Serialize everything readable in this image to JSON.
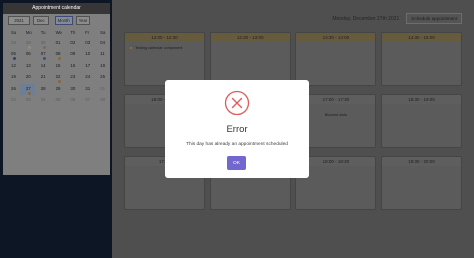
{
  "sidebar": {
    "title": "Appointment calendar",
    "controls": {
      "year": "2021",
      "month": "Dec",
      "view_month": "Month",
      "view_year": "Year"
    },
    "weekdays": [
      "Su",
      "Mo",
      "Tu",
      "We",
      "Th",
      "Fr",
      "Sa"
    ],
    "weeks": [
      [
        {
          "d": "28",
          "m": 1
        },
        {
          "d": "29",
          "m": 1,
          "dot": "#9a8a78"
        },
        {
          "d": "30",
          "m": 1,
          "dot": "#7a6a5a"
        },
        {
          "d": "01"
        },
        {
          "d": "02"
        },
        {
          "d": "03"
        },
        {
          "d": "04"
        }
      ],
      [
        {
          "d": "05",
          "dot": "#2f3f86"
        },
        {
          "d": "06"
        },
        {
          "d": "07",
          "dot": "#3a4a9a"
        },
        {
          "d": "08",
          "dot": "#8a6830"
        },
        {
          "d": "09"
        },
        {
          "d": "10"
        },
        {
          "d": "11"
        }
      ],
      [
        {
          "d": "12"
        },
        {
          "d": "13"
        },
        {
          "d": "14"
        },
        {
          "d": "15"
        },
        {
          "d": "16"
        },
        {
          "d": "17"
        },
        {
          "d": "18"
        }
      ],
      [
        {
          "d": "19"
        },
        {
          "d": "20"
        },
        {
          "d": "21"
        },
        {
          "d": "22",
          "dot": "#8a6830"
        },
        {
          "d": "23"
        },
        {
          "d": "24"
        },
        {
          "d": "25"
        }
      ],
      [
        {
          "d": "26"
        },
        {
          "d": "27",
          "today": 1,
          "dot": "#8a6830"
        },
        {
          "d": "28"
        },
        {
          "d": "29"
        },
        {
          "d": "30"
        },
        {
          "d": "31"
        },
        {
          "d": "01",
          "m": 1
        }
      ],
      [
        {
          "d": "02",
          "m": 1
        },
        {
          "d": "03",
          "m": 1
        },
        {
          "d": "04",
          "m": 1
        },
        {
          "d": "05",
          "m": 1
        },
        {
          "d": "06",
          "m": 1
        },
        {
          "d": "07",
          "m": 1
        },
        {
          "d": "08",
          "m": 1
        }
      ]
    ]
  },
  "header": {
    "date": "Monday, December 27th 2021",
    "schedule_button": "Schedule appointment"
  },
  "slots": [
    {
      "time": "12:00 - 12:30",
      "booked": true,
      "entry": "Testing calendar component"
    },
    {
      "time": "12:30 - 13:00",
      "booked": true
    },
    {
      "time": "13:30 - 14:00",
      "booked": true
    },
    {
      "time": "14:30 - 15:00",
      "booked": true
    },
    {
      "time": "16:00 - 16:30"
    },
    {
      "time": "16:30 - 17:00"
    },
    {
      "time": "17:00 - 17:30",
      "note": "Blocked slots"
    },
    {
      "time": "18:30 - 19:00"
    },
    {
      "time": "17:00"
    },
    {
      "time": ""
    },
    {
      "time": "19:00 - 19:30"
    },
    {
      "time": "19:30 - 20:00"
    }
  ],
  "modal": {
    "title": "Error",
    "message": "This day has already an appointment scheduled",
    "ok_button": "OK"
  },
  "colors": {
    "accent": "#7266cf",
    "error": "#e25a5a"
  }
}
